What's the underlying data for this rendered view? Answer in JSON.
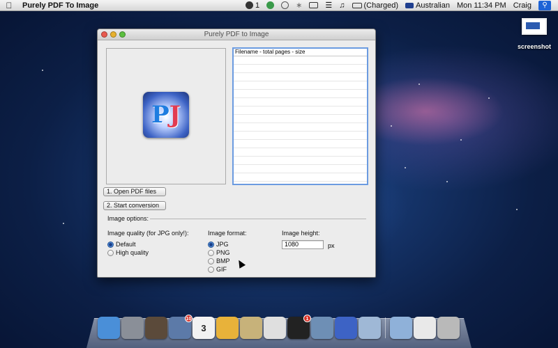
{
  "menubar": {
    "app_name": "Purely PDF To Image",
    "status": {
      "qq_count": "1",
      "battery_text": "(Charged)",
      "input_source": "Australian",
      "datetime": "Mon 11:34 PM",
      "user": "Craig"
    }
  },
  "desktop": {
    "icon_label": "screenshot"
  },
  "window": {
    "title": "Purely PDF to Image",
    "file_list_header": "Filename - total pages - size",
    "buttons": {
      "open": "1. Open PDF files",
      "start": "2. Start conversion"
    },
    "options_label": "Image options:",
    "quality": {
      "title": "Image quality (for JPG only!):",
      "options": [
        "Default",
        "High quality"
      ],
      "selected": "Default"
    },
    "format": {
      "title": "Image format:",
      "options": [
        "JPG",
        "PNG",
        "BMP",
        "GIF"
      ],
      "selected": "JPG"
    },
    "height": {
      "title": "Image height:",
      "value": "1080",
      "unit": "px"
    },
    "logo_letters": [
      "P",
      "J"
    ]
  },
  "dock": {
    "items": [
      {
        "name": "finder-icon",
        "color": "#4a8fd8"
      },
      {
        "name": "launchpad-icon",
        "color": "#8a8f98"
      },
      {
        "name": "photo-icon",
        "color": "#5b4a3a"
      },
      {
        "name": "mail-icon",
        "color": "#5c7aa8",
        "badge": "10"
      },
      {
        "name": "calendar-icon",
        "color": "#f2f2f2",
        "text": "3"
      },
      {
        "name": "chrome-icon",
        "color": "#e8b23a"
      },
      {
        "name": "clock-icon",
        "color": "#c7b27a"
      },
      {
        "name": "textedit-icon",
        "color": "#dfdfdf"
      },
      {
        "name": "qq-icon",
        "color": "#222222",
        "badge": "1"
      },
      {
        "name": "tools-icon",
        "color": "#6e8fb5"
      },
      {
        "name": "purely-pdf-icon",
        "color": "#3d63c5"
      },
      {
        "name": "preview-icon",
        "color": "#9fb8d6"
      },
      {
        "name": "folder-icon",
        "color": "#8fb1d9"
      },
      {
        "name": "documents-icon",
        "color": "#e9e9e9"
      },
      {
        "name": "trash-icon",
        "color": "#b9b9b9"
      }
    ]
  }
}
